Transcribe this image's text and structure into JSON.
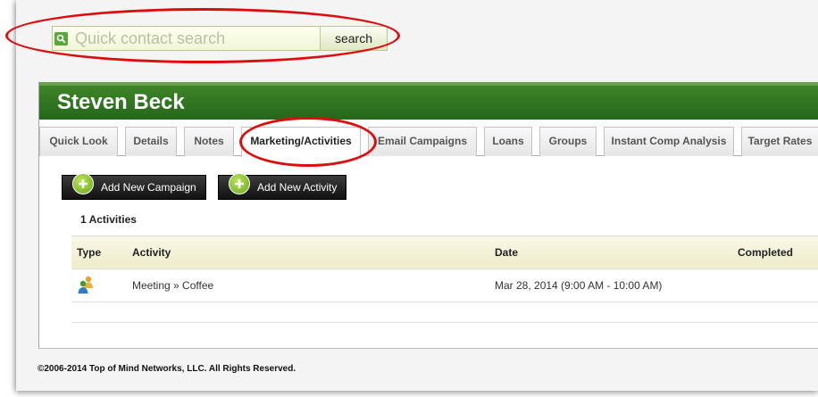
{
  "search": {
    "placeholder": "Quick contact search",
    "value": "",
    "button_label": "search"
  },
  "contact": {
    "name": "Steven Beck"
  },
  "tabs": [
    {
      "label": "Quick Look",
      "active": false
    },
    {
      "label": "Details",
      "active": false
    },
    {
      "label": "Notes",
      "active": false
    },
    {
      "label": "Marketing/Activities",
      "active": true
    },
    {
      "label": "Email Campaigns",
      "active": false
    },
    {
      "label": "Loans",
      "active": false
    },
    {
      "label": "Groups",
      "active": false
    },
    {
      "label": "Instant Comp Analysis",
      "active": false
    },
    {
      "label": "Target Rates",
      "active": false
    }
  ],
  "actions": {
    "add_campaign_label": "Add New Campaign",
    "add_activity_label": "Add New Activity"
  },
  "activities": {
    "count_label": "1 Activities",
    "columns": [
      "Type",
      "Activity",
      "Date",
      "Completed"
    ],
    "rows": [
      {
        "type_icon": "meeting-people-icon",
        "activity": "Meeting » Coffee",
        "date": "Mar 28, 2014 (9:00 AM - 10:00 AM)",
        "completed": ""
      }
    ]
  },
  "footer": {
    "copyright": "©2006-2014 Top of Mind Networks, LLC. All Rights Reserved."
  },
  "colors": {
    "header_green": "#2f7320",
    "annotation_red": "#dd0d0d",
    "search_icon_green": "#58a83c"
  }
}
